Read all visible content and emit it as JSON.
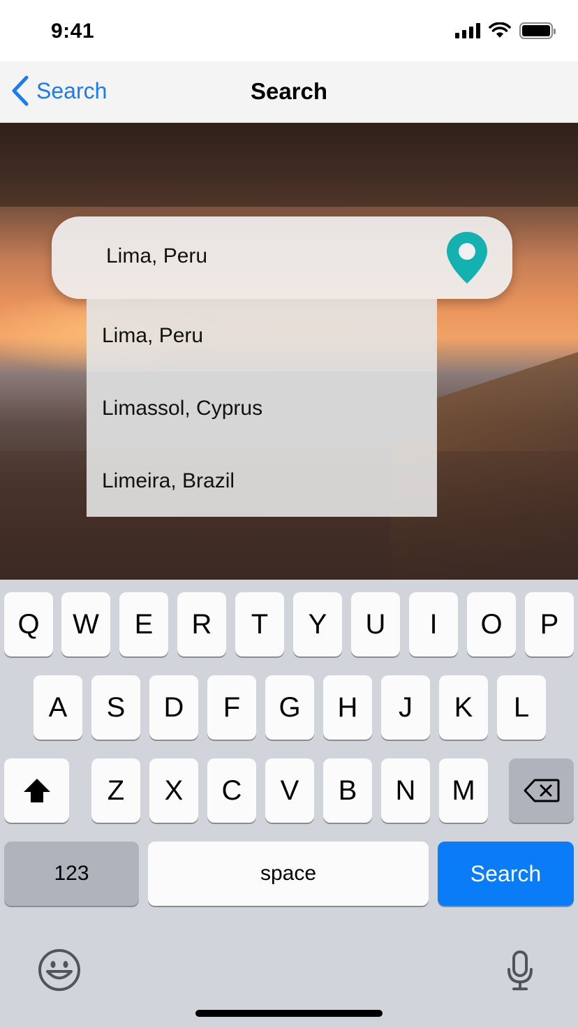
{
  "status_bar": {
    "time": "9:41"
  },
  "nav": {
    "back_label": "Search",
    "title": "Search"
  },
  "search": {
    "value": "Lima, Peru",
    "accent_color": "#13b2b0"
  },
  "suggestions": [
    {
      "label": "Lima, Peru"
    },
    {
      "label": "Limassol, Cyprus"
    },
    {
      "label": "Limeira, Brazil"
    }
  ],
  "keyboard": {
    "row1": [
      "Q",
      "W",
      "E",
      "R",
      "T",
      "Y",
      "U",
      "I",
      "O",
      "P"
    ],
    "row2": [
      "A",
      "S",
      "D",
      "F",
      "G",
      "H",
      "J",
      "K",
      "L"
    ],
    "row3": [
      "Z",
      "X",
      "C",
      "V",
      "B",
      "N",
      "M"
    ],
    "numbers_label": "123",
    "space_label": "space",
    "return_label": "Search",
    "icons": {
      "shift": "shift-icon",
      "delete": "delete-icon",
      "emoji": "emoji-icon",
      "mic": "microphone-icon"
    },
    "return_color": "#0a7cf7"
  }
}
